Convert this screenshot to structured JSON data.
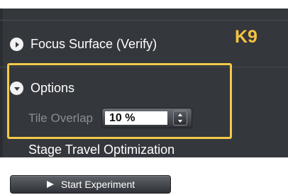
{
  "panel": {
    "focus_surface": {
      "label": "Focus Surface (Verify)",
      "icon": "circle-arrow-right-icon"
    },
    "options": {
      "label": "Options",
      "icon": "circle-arrow-down-icon"
    },
    "tile_overlap": {
      "label": "Tile Overlap",
      "value": "10 %"
    },
    "stage_travel": {
      "label": "Stage Travel Optimization"
    }
  },
  "annotation": {
    "label": "K9",
    "color": "#f2ca4a"
  },
  "start_button": {
    "label": "Start Experiment",
    "icon": "play-icon"
  }
}
